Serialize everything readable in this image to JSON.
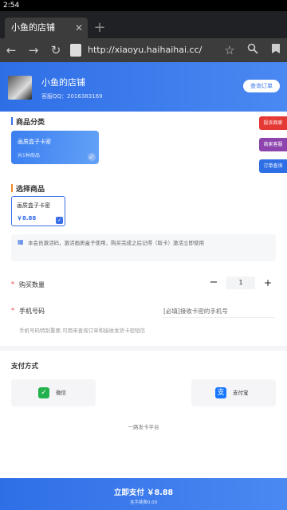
{
  "status_bar": {
    "time": "2:54"
  },
  "browser": {
    "tab_title": "小鱼的店铺",
    "url": "http://xiaoyu.haihaihai.cc/"
  },
  "shop": {
    "name": "小鱼的店铺",
    "qq": "客服QQ：2016383169",
    "order_query_label": "查询订单"
  },
  "category_section": {
    "title": "商品分类",
    "items": [
      {
        "name": "画质盒子卡密",
        "count": "共1种商品"
      }
    ]
  },
  "side_buttons": [
    {
      "label": "投诉商家",
      "color": "#e53935"
    },
    {
      "label": "商家客服",
      "color": "#8e44ad"
    },
    {
      "label": "订单查询",
      "color": "#2f6fe6"
    }
  ],
  "product_section": {
    "title": "选择商品",
    "items": [
      {
        "name": "画质盒子卡密",
        "price": "￥8.88"
      }
    ],
    "notice": "本会员激活码，激活画质盒子使用，购买完成之后记得（取卡）激活立即使用"
  },
  "form": {
    "quantity_label": "购买数量",
    "quantity_value": "1",
    "minus": "−",
    "plus": "+",
    "phone_label": "手机号码",
    "phone_placeholder": "[必填]接收卡密的手机号",
    "phone_hint": "手机号码特别重要,可用来查询订单和接收发货卡密短信",
    "required_mark": "*"
  },
  "payment": {
    "title": "支付方式",
    "methods": [
      {
        "name": "微信",
        "icon": "wechat-icon",
        "color": "#22b14c"
      },
      {
        "name": "支付宝",
        "icon": "alipay-icon",
        "color": "#1677ff"
      }
    ]
  },
  "platform": "一路发卡平台",
  "pay_bar": {
    "label": "立即支付 ￥8.88",
    "fee": "含手续费0.00"
  },
  "colors": {
    "accent": "#2f6fe6",
    "danger": "#e53935"
  }
}
